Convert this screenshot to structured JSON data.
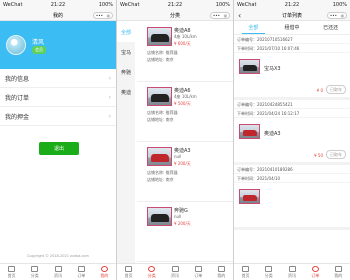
{
  "status": {
    "carrier": "WeChat",
    "time": "21:22",
    "battery": "100%"
  },
  "capsule": {
    "more": "•••",
    "close": "◎"
  },
  "profile": {
    "title": "我的",
    "user": {
      "name": "清风",
      "badge": "会员"
    },
    "menu": [
      {
        "label": "我的信息"
      },
      {
        "label": "我的订单"
      },
      {
        "label": "我的押金"
      }
    ],
    "logout": "退出",
    "copyright": "Copyright © 2018-2021 xxdsa.com"
  },
  "category": {
    "title": "分类",
    "sidebar": [
      {
        "label": "全部"
      },
      {
        "label": "宝马"
      },
      {
        "label": "奔驰"
      },
      {
        "label": "奥迪"
      }
    ],
    "cars": [
      {
        "name": "奥迪A8",
        "spec": "4座 10L/km",
        "price": "¥ 600/天",
        "store": "店铺名称: 推荐器",
        "addr": "店铺地址: 南京",
        "color": "dark"
      },
      {
        "name": "奥迪A6",
        "spec": "4座 10L/km",
        "price": "¥ 500/天",
        "store": "店铺名称: 推荐器",
        "addr": "店铺地址: 南京",
        "color": "dark"
      },
      {
        "name": "奥迪A3",
        "spec": "null",
        "price": "¥ 200/天",
        "store": "店铺名称: 推荐器",
        "addr": "店铺地址: 南京",
        "color": "red"
      },
      {
        "name": "奔驰G",
        "spec": "null",
        "price": "¥ 200/天",
        "store": "",
        "addr": "",
        "color": "dark"
      }
    ]
  },
  "orders": {
    "title": "订单列表",
    "tabs": [
      "全部",
      "租借中",
      "已还还"
    ],
    "list": [
      {
        "no": "订单编号：20210710516627",
        "time": "下单时间：2021/07/10 16:07:46",
        "car": "宝马X3",
        "amount": "¥ 0",
        "status": "已取车",
        "color": "dark"
      },
      {
        "no": "订单编号：20210424855421",
        "time": "下单时间：2021/04/24 16:12:17",
        "car": "奥迪A3",
        "amount": "¥ 50",
        "status": "已取车",
        "color": "red"
      },
      {
        "no": "订单编号：20210410189286",
        "time": "下单时间：2021/04/10",
        "car": "",
        "amount": "",
        "status": "",
        "color": "red"
      }
    ]
  },
  "tabbar": [
    {
      "label": "首页"
    },
    {
      "label": "分类"
    },
    {
      "label": "资讯"
    },
    {
      "label": "订单"
    },
    {
      "label": "我的"
    }
  ]
}
